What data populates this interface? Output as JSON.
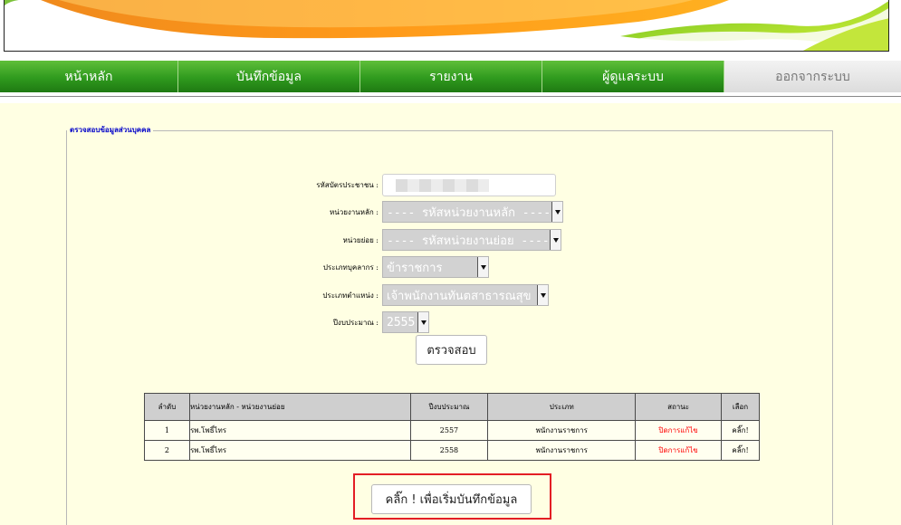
{
  "nav": {
    "items": [
      "หน้าหลัก",
      "บันทึกข้อมูล",
      "รายงาน",
      "ผู้ดูแลระบบ",
      "ออกจากระบบ"
    ]
  },
  "form": {
    "legend": "ตรวจสอบข้อมูลส่วนบุคคล",
    "fields": {
      "citizen_id": {
        "label": "รหัสบัตรประชาชน :",
        "value": ""
      },
      "main_unit": {
        "label": "หน่วยงานหลัก :",
        "value": "---- รหัสหน่วยงานหลัก ----"
      },
      "sub_unit": {
        "label": "หน่วยย่อย :",
        "value": "---- รหัสหน่วยงานย่อย ----"
      },
      "personnel_type": {
        "label": "ประเภทบุคลากร :",
        "value": "ข้าราชการ"
      },
      "position_type": {
        "label": "ประเภทตำแหน่ง :",
        "value": "เจ้าพนักงานทันตสาธารณสุข"
      },
      "fiscal_year": {
        "label": "ปีงบประมาณ :",
        "value": "2555"
      }
    },
    "check_button": "ตรวจสอบ"
  },
  "table": {
    "headers": [
      "ลำดับ",
      "หน่วยงานหลัก - หน่วยงานย่อย",
      "ปีงบประมาณ",
      "ประเภท",
      "สถานะ",
      "เลือก"
    ],
    "rows": [
      [
        "1",
        "รพ.โพธิ์ไทร",
        "2557",
        "พนักงานราชการ",
        "ปิดการแก้ไข",
        "คลิ๊ก!"
      ],
      [
        "2",
        "รพ.โพธิ์ไทร",
        "2558",
        "พนักงานราชการ",
        "ปิดการแก้ไข",
        "คลิ๊ก!"
      ]
    ]
  },
  "start_button": "คลิ๊ก ! เพื่อเริ่มบันทึกข้อมูล",
  "colors": {
    "nav_green": "#2f9a1e",
    "background": "#ffffe3",
    "status_red": "#ff0000",
    "highlight_red": "#e31e24"
  }
}
